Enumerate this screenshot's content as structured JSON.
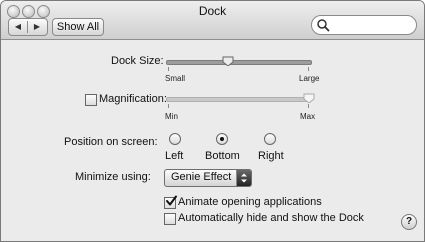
{
  "window": {
    "title": "Dock"
  },
  "toolbar": {
    "back_label": "◀",
    "forward_label": "▶",
    "show_all_label": "Show All",
    "search_placeholder": ""
  },
  "dock_size": {
    "label": "Dock Size:",
    "min_label": "Small",
    "max_label": "Large",
    "value": 0.43
  },
  "magnification": {
    "label": "Magnification:",
    "checked": false,
    "min_label": "Min",
    "max_label": "Max",
    "value": 1.0
  },
  "position": {
    "label": "Position on screen:",
    "options": [
      {
        "label": "Left",
        "selected": false
      },
      {
        "label": "Bottom",
        "selected": true
      },
      {
        "label": "Right",
        "selected": false
      }
    ]
  },
  "minimize": {
    "label": "Minimize using:",
    "selected": "Genie Effect"
  },
  "options": {
    "animate_label": "Animate opening applications",
    "animate_checked": true,
    "autohide_label": "Automatically hide and show the Dock",
    "autohide_checked": false
  },
  "help": {
    "label": "?"
  },
  "colors": {
    "toolbar_top": "#eeeeee",
    "toolbar_bottom": "#cfcfcf",
    "content_bg": "#ebebeb"
  }
}
